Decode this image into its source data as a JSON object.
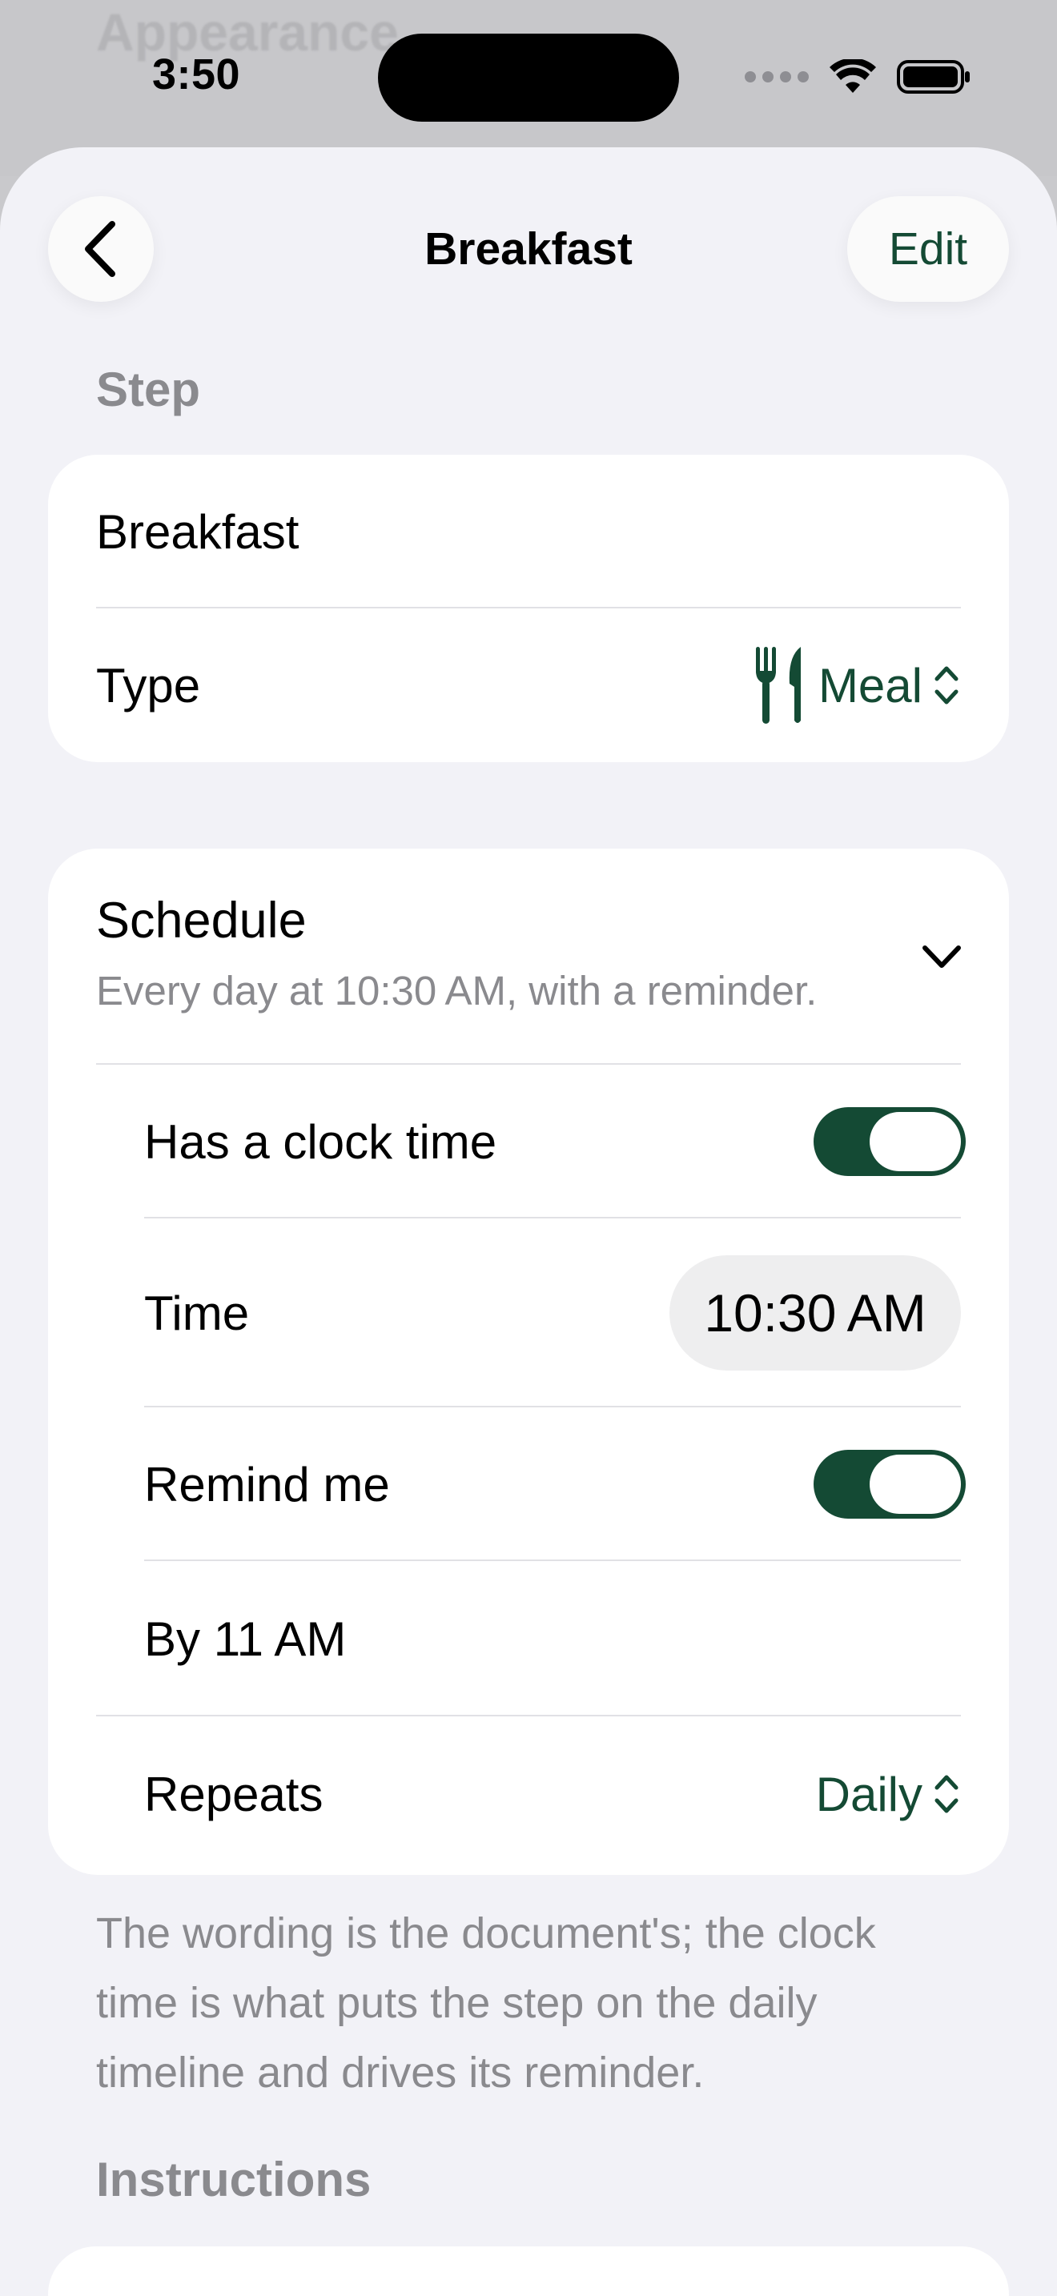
{
  "status_bar": {
    "time": "3:50"
  },
  "background_sheet": {
    "title": "Appearance"
  },
  "nav": {
    "title": "Breakfast",
    "back_icon": "chevron-left-icon",
    "edit_label": "Edit"
  },
  "sections": {
    "step_header": "Step",
    "instructions_header": "Instructions"
  },
  "step": {
    "name": "Breakfast",
    "type_label": "Type",
    "type_value": "Meal",
    "type_icon": "fork-knife-icon"
  },
  "schedule": {
    "title": "Schedule",
    "summary": "Every day at 10:30 AM, with a reminder.",
    "has_clock_time_label": "Has a clock time",
    "has_clock_time_on": true,
    "time_label": "Time",
    "time_value": "10:30 AM",
    "remind_label": "Remind me",
    "remind_on": true,
    "by_label": "By 11 AM",
    "repeats_label": "Repeats",
    "repeats_value": "Daily"
  },
  "footer": {
    "note": "The wording is the document's; the clock time is what puts the step on the daily timeline and drives its reminder."
  },
  "colors": {
    "accent": "#144a34",
    "background": "#f2f2f7",
    "card": "#ffffff",
    "secondary_text": "#8a8a8e"
  }
}
